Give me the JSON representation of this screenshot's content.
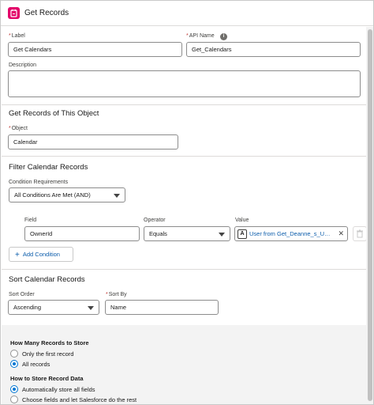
{
  "header": {
    "title": "Get Records",
    "icon": "get-records-icon",
    "icon_color": "#e3066a"
  },
  "label_field": {
    "label": "Label",
    "value": "Get Calendars"
  },
  "api_name_field": {
    "label": "API Name",
    "value": "Get_Calendars"
  },
  "description_field": {
    "label": "Description",
    "value": ""
  },
  "object_section": {
    "title": "Get Records of This Object",
    "object_label": "Object",
    "object_value": "Calendar"
  },
  "filter_section": {
    "title": "Filter Calendar Records",
    "condition_label": "Condition Requirements",
    "condition_value": "All Conditions Are Met (AND)",
    "columns": {
      "field": "Field",
      "operator": "Operator",
      "value": "Value"
    },
    "row": {
      "field": "OwnerId",
      "operator": "Equals",
      "value": "User from Get_Deanne_s_User..."
    },
    "add_condition": "Add Condition"
  },
  "sort_section": {
    "title": "Sort Calendar Records",
    "order_label": "Sort Order",
    "order_value": "Ascending",
    "by_label": "Sort By",
    "by_value": "Name"
  },
  "store_section": {
    "how_many_title": "How Many Records to Store",
    "how_many_options": [
      "Only the first record",
      "All records"
    ],
    "how_many_selected": "All records",
    "how_store_title": "How to Store Record Data",
    "how_store_options": [
      "Automatically store all fields",
      "Choose fields and let Salesforce do the rest"
    ],
    "how_store_selected": "Automatically store all fields"
  },
  "colors": {
    "accent": "#0176d3",
    "link": "#0b5cab",
    "required": "#c23934"
  }
}
